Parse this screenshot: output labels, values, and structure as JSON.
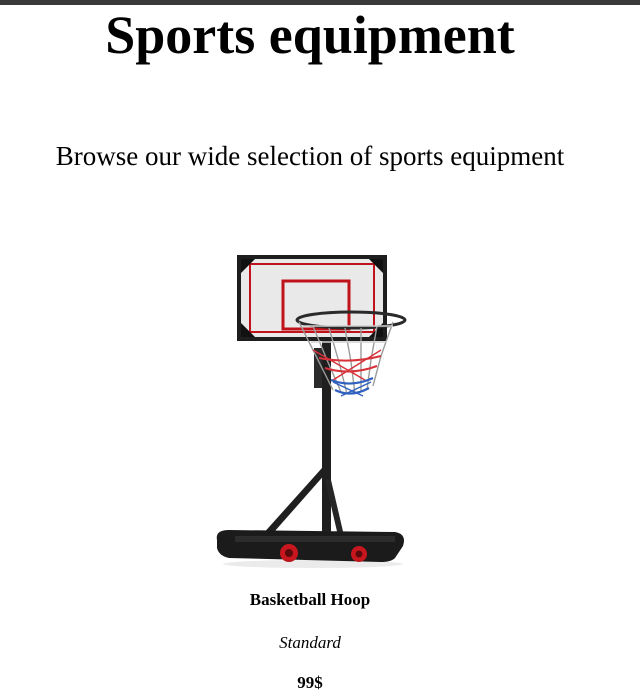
{
  "page": {
    "title": "Sports equipment",
    "subtitle": "Browse our wide selection of sports equipment"
  },
  "product": {
    "name": "Basketball Hoop",
    "variant": "Standard",
    "price": "99$",
    "image_icon": "basketball-hoop-image",
    "colors": {
      "frame": "#1f1f1f",
      "backboard_trim": "#c0121a",
      "net_red": "#d8323a",
      "net_blue": "#2f5fbf"
    }
  }
}
